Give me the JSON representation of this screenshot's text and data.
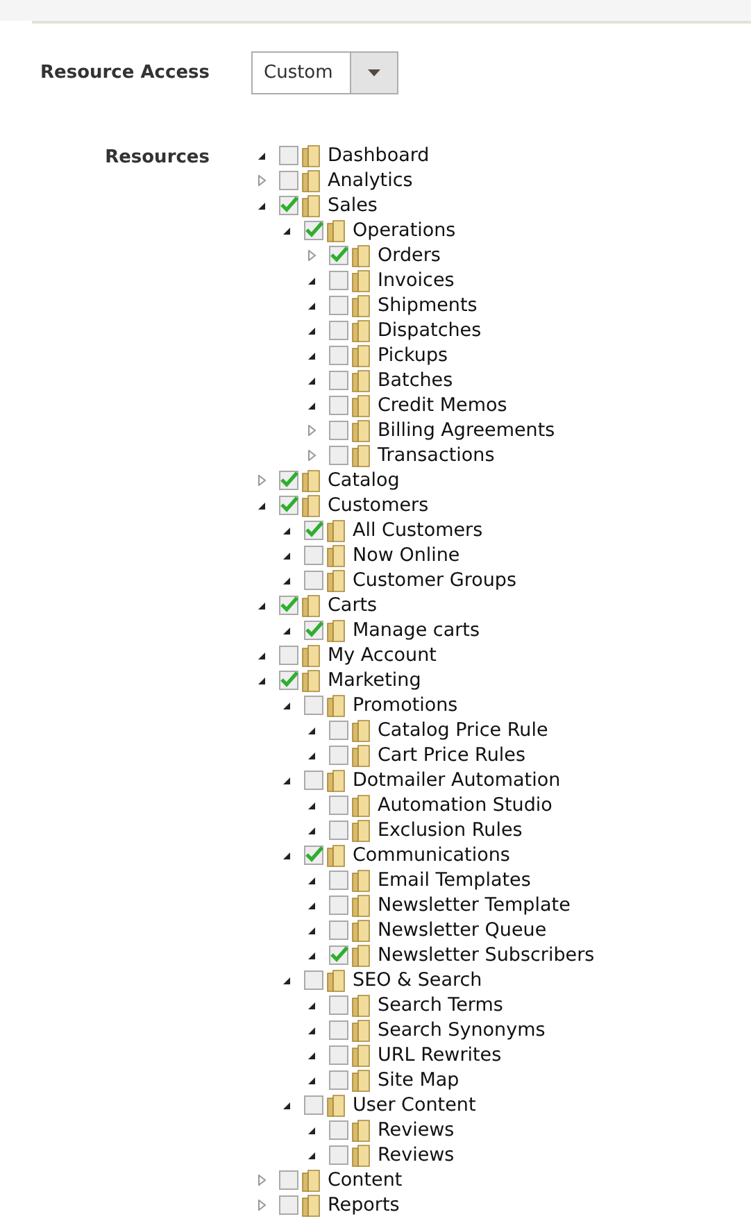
{
  "resource_access": {
    "label": "Resource Access",
    "value": "Custom"
  },
  "resources": {
    "label": "Resources",
    "tree": [
      {
        "label": "Dashboard",
        "expanded": true,
        "checked": false
      },
      {
        "label": "Analytics",
        "expanded": false,
        "checked": false
      },
      {
        "label": "Sales",
        "expanded": true,
        "checked": true,
        "children": [
          {
            "label": "Operations",
            "expanded": true,
            "checked": true,
            "children": [
              {
                "label": "Orders",
                "expanded": false,
                "checked": true
              },
              {
                "label": "Invoices",
                "expanded": true,
                "checked": false
              },
              {
                "label": "Shipments",
                "expanded": true,
                "checked": false
              },
              {
                "label": "Dispatches",
                "expanded": true,
                "checked": false
              },
              {
                "label": "Pickups",
                "expanded": true,
                "checked": false
              },
              {
                "label": "Batches",
                "expanded": true,
                "checked": false
              },
              {
                "label": "Credit Memos",
                "expanded": true,
                "checked": false
              },
              {
                "label": "Billing Agreements",
                "expanded": false,
                "checked": false
              },
              {
                "label": "Transactions",
                "expanded": false,
                "checked": false
              }
            ]
          }
        ]
      },
      {
        "label": "Catalog",
        "expanded": false,
        "checked": true
      },
      {
        "label": "Customers",
        "expanded": true,
        "checked": true,
        "children": [
          {
            "label": "All Customers",
            "expanded": true,
            "checked": true
          },
          {
            "label": "Now Online",
            "expanded": true,
            "checked": false
          },
          {
            "label": "Customer Groups",
            "expanded": true,
            "checked": false
          }
        ]
      },
      {
        "label": "Carts",
        "expanded": true,
        "checked": true,
        "children": [
          {
            "label": "Manage carts",
            "expanded": true,
            "checked": true
          }
        ]
      },
      {
        "label": "My Account",
        "expanded": true,
        "checked": false
      },
      {
        "label": "Marketing",
        "expanded": true,
        "checked": true,
        "children": [
          {
            "label": "Promotions",
            "expanded": true,
            "checked": false,
            "children": [
              {
                "label": "Catalog Price Rule",
                "expanded": true,
                "checked": false
              },
              {
                "label": "Cart Price Rules",
                "expanded": true,
                "checked": false
              }
            ]
          },
          {
            "label": "Dotmailer Automation",
            "expanded": true,
            "checked": false,
            "children": [
              {
                "label": "Automation Studio",
                "expanded": true,
                "checked": false
              },
              {
                "label": "Exclusion Rules",
                "expanded": true,
                "checked": false
              }
            ]
          },
          {
            "label": "Communications",
            "expanded": true,
            "checked": true,
            "children": [
              {
                "label": "Email Templates",
                "expanded": true,
                "checked": false
              },
              {
                "label": "Newsletter Template",
                "expanded": true,
                "checked": false
              },
              {
                "label": "Newsletter Queue",
                "expanded": true,
                "checked": false
              },
              {
                "label": "Newsletter Subscribers",
                "expanded": true,
                "checked": true
              }
            ]
          },
          {
            "label": "SEO & Search",
            "expanded": true,
            "checked": false,
            "children": [
              {
                "label": "Search Terms",
                "expanded": true,
                "checked": false
              },
              {
                "label": "Search Synonyms",
                "expanded": true,
                "checked": false
              },
              {
                "label": "URL Rewrites",
                "expanded": true,
                "checked": false
              },
              {
                "label": "Site Map",
                "expanded": true,
                "checked": false
              }
            ]
          },
          {
            "label": "User Content",
            "expanded": true,
            "checked": false,
            "children": [
              {
                "label": "Reviews",
                "expanded": true,
                "checked": false
              },
              {
                "label": "Reviews",
                "expanded": true,
                "checked": false
              }
            ]
          }
        ]
      },
      {
        "label": "Content",
        "expanded": false,
        "checked": false
      },
      {
        "label": "Reports",
        "expanded": false,
        "checked": false
      }
    ]
  }
}
